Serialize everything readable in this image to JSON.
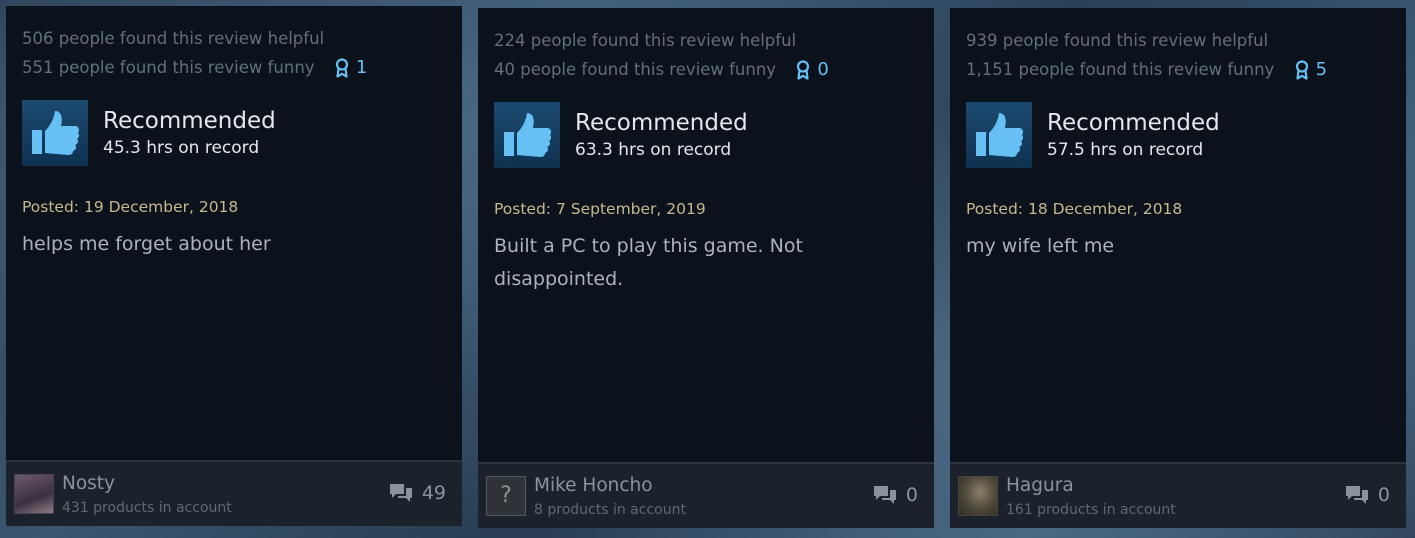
{
  "reviews": [
    {
      "helpful_text": "506 people found this review helpful",
      "funny_text": "551 people found this review funny",
      "award_count": "1",
      "verdict": "Recommended",
      "hours": "45.3 hrs on record",
      "posted": "Posted: 19 December, 2018",
      "text": "helps me forget about her",
      "author": "Nosty",
      "products": "431 products in account",
      "comment_count": "49"
    },
    {
      "helpful_text": "224 people found this review helpful",
      "funny_text": "40 people found this review funny",
      "award_count": "0",
      "verdict": "Recommended",
      "hours": "63.3 hrs on record",
      "posted": "Posted: 7 September, 2019",
      "text": "Built a PC to play this game. Not disappointed.",
      "author": "Mike Honcho",
      "avatar_placeholder": "?",
      "products": "8 products in account",
      "comment_count": "0"
    },
    {
      "helpful_text": "939 people found this review helpful",
      "funny_text": "1,151 people found this review funny",
      "award_count": "5",
      "verdict": "Recommended",
      "hours": "57.5 hrs on record",
      "posted": "Posted: 18 December, 2018",
      "text": "my wife left me",
      "author": "Hagura",
      "products": "161 products in account",
      "comment_count": "0"
    }
  ],
  "colors": {
    "award": "#66c0f4",
    "thumb": "#66c0f4",
    "posted": "#c6b98f"
  },
  "icons": {
    "award": "award-ribbon-icon",
    "verdict": "thumbs-up-icon",
    "comments": "speech-bubbles-icon"
  }
}
